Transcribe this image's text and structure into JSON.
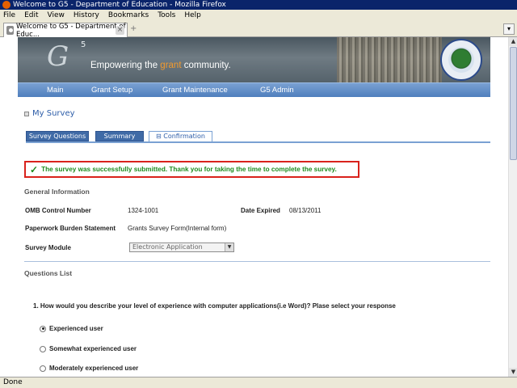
{
  "window": {
    "title": "Welcome to G5 - Department of Education - Mozilla Firefox"
  },
  "menu": [
    "File",
    "Edit",
    "View",
    "History",
    "Bookmarks",
    "Tools",
    "Help"
  ],
  "browser_tab": {
    "label": "Welcome to G5 - Department of Educ...",
    "new_tab": "+"
  },
  "status": "Done",
  "banner": {
    "logo_g": "G",
    "logo_5": "5",
    "tagline_pre": "Empowering the ",
    "tagline_grant": "grant",
    "tagline_post": " community."
  },
  "nav": [
    "Main",
    "Grant Setup",
    "Grant Maintenance",
    "G5 Admin"
  ],
  "page_title": "My Survey",
  "tabs": [
    "Survey Questions",
    "Summary",
    "Confirmation"
  ],
  "success_message": "The survey was successfully submitted. Thank you for taking the time to complete the survey.",
  "general": {
    "heading": "General Information",
    "omb_label": "OMB Control Number",
    "omb_value": "1324-1001",
    "date_label": "Date Expired",
    "date_value": "08/13/2011",
    "pbs_label": "Paperwork Burden Statement",
    "pbs_value": "Grants Survey Form(Internal form)",
    "module_label": "Survey Module",
    "module_value": "Electronic Application"
  },
  "questions": {
    "heading": "Questions List",
    "q1": "1. How would you describe your level of experience with computer applications(i.e Word)? Plase select your response",
    "options": [
      "Experienced user",
      "Somewhat experienced user",
      "Moderately experienced user"
    ]
  }
}
